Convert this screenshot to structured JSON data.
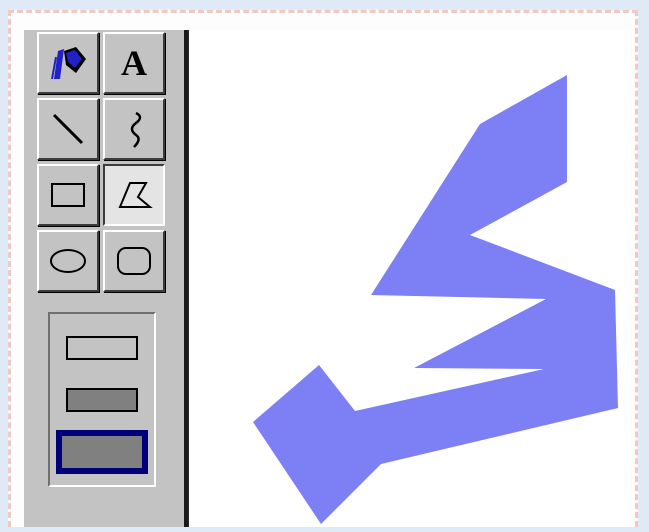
{
  "window": {
    "title": ""
  },
  "toolbox": {
    "tools": [
      {
        "id": "fill",
        "icon": "paint-bucket-icon"
      },
      {
        "id": "text",
        "icon": "text-icon",
        "glyph": "A"
      },
      {
        "id": "line",
        "icon": "line-icon"
      },
      {
        "id": "curve",
        "icon": "curve-icon"
      },
      {
        "id": "rectangle",
        "icon": "rectangle-icon"
      },
      {
        "id": "polygon",
        "icon": "polygon-icon",
        "selected": true
      },
      {
        "id": "ellipse",
        "icon": "ellipse-icon"
      },
      {
        "id": "rounded-rectangle",
        "icon": "rounded-rectangle-icon"
      }
    ],
    "fill_styles": [
      {
        "id": "outline-only",
        "selected": false
      },
      {
        "id": "outline-and-fill",
        "selected": false
      },
      {
        "id": "fill-only",
        "selected": true
      }
    ]
  },
  "canvas": {
    "background": "#ffffff",
    "shape": {
      "type": "polygon",
      "fill_color": "#7d7ff5"
    }
  },
  "colors": {
    "toolbox_face": "#c3c3c3",
    "selection_border": "#00007b",
    "fill_gray": "#808080",
    "brush_blue": "#2121c7"
  }
}
